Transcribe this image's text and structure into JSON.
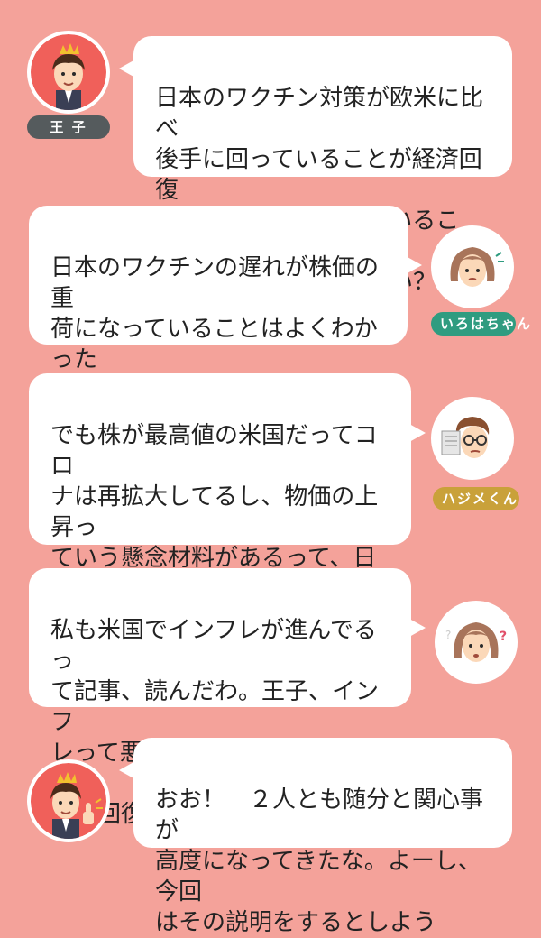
{
  "colors": {
    "background": "#f4a29a",
    "bubble": "#ffffff",
    "prince_tag": "#555b5d",
    "iroha_tag": "#2f9c80",
    "hajime_tag": "#c9a13a"
  },
  "conversation": [
    {
      "speaker": "王 子",
      "avatar_icon": "prince-avatar-icon",
      "text": "日本のワクチン対策が欧米に比べ\n後手に回っていることが経済回復\n度合いに如実に表れていること、前\n回の説明でわかったかい？"
    },
    {
      "speaker": "いろはちゃん",
      "avatar_icon": "iroha-avatar-icon",
      "text": "日本のワクチンの遅れが株価の重\n荷になっていることはよくわかった\nわ。若者向けの渋谷の接種会場の\n混乱もひどいし……"
    },
    {
      "speaker": "ハジメくん",
      "avatar_icon": "hajime-avatar-icon",
      "text": "でも株が最高値の米国だってコロ\nナは再拡大してるし、物価の上昇っ\nていう懸念材料があるって、日経で\n読んだよ。どう読み解けばいいかチ\nンプンカンプンで"
    },
    {
      "speaker": "",
      "avatar_icon": "iroha-confused-avatar-icon",
      "text": "私も米国でインフレが進んでるっ\nて記事、読んだわ。王子、インフ\nレって悪いことなの？　それとも\n景気回復の結果？"
    },
    {
      "speaker": "",
      "avatar_icon": "prince-thumbs-up-avatar-icon",
      "text": "おお！　２人とも随分と関心事が\n高度になってきたな。よーし、今回\nはその説明をするとしよう"
    }
  ]
}
